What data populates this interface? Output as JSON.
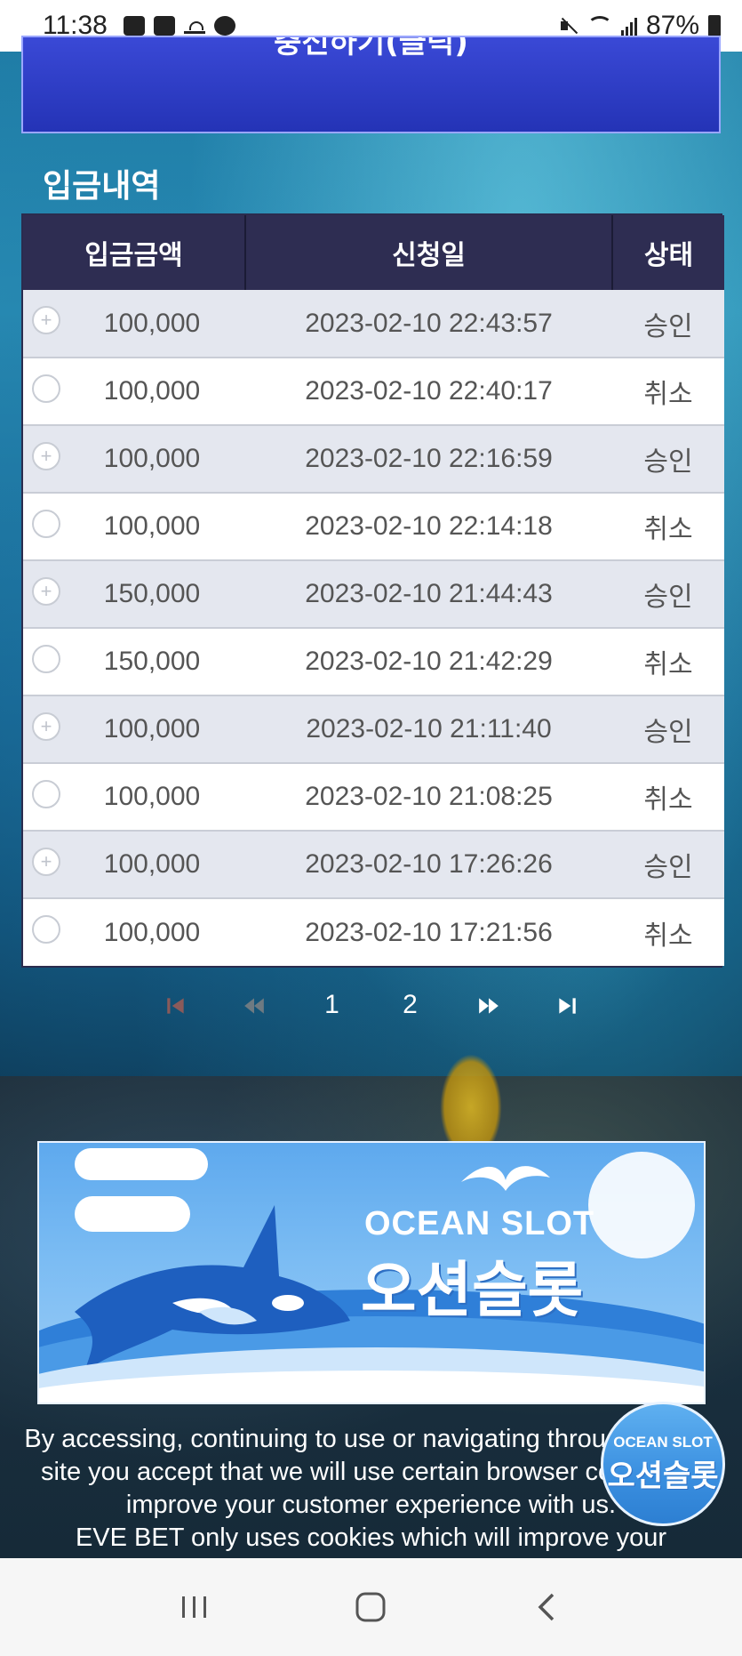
{
  "status_bar": {
    "time": "11:38",
    "battery": "87%"
  },
  "top_button": {
    "label": "충전하기(클릭)"
  },
  "section": {
    "title": "입금내역"
  },
  "table": {
    "headers": [
      "입금금액",
      "신청일",
      "상태"
    ],
    "rows": [
      {
        "amount": "100,000",
        "date": "2023-02-10 22:43:57",
        "status": "승인"
      },
      {
        "amount": "100,000",
        "date": "2023-02-10 22:40:17",
        "status": "취소"
      },
      {
        "amount": "100,000",
        "date": "2023-02-10 22:16:59",
        "status": "승인"
      },
      {
        "amount": "100,000",
        "date": "2023-02-10 22:14:18",
        "status": "취소"
      },
      {
        "amount": "150,000",
        "date": "2023-02-10 21:44:43",
        "status": "승인"
      },
      {
        "amount": "150,000",
        "date": "2023-02-10 21:42:29",
        "status": "취소"
      },
      {
        "amount": "100,000",
        "date": "2023-02-10 21:11:40",
        "status": "승인"
      },
      {
        "amount": "100,000",
        "date": "2023-02-10 21:08:25",
        "status": "취소"
      },
      {
        "amount": "100,000",
        "date": "2023-02-10 17:26:26",
        "status": "승인"
      },
      {
        "amount": "100,000",
        "date": "2023-02-10 17:21:56",
        "status": "취소"
      }
    ]
  },
  "pagination": {
    "pages": [
      "1",
      "2"
    ],
    "icons": [
      "first-page-icon",
      "prev-page-icon",
      "next-page-icon",
      "last-page-icon"
    ]
  },
  "banner": {
    "text_en": "OCEAN SLOT",
    "text_ko": "오션슬롯"
  },
  "badge": {
    "text_en": "OCEAN SLOT",
    "text_ko": "오션슬롯"
  },
  "cookie": {
    "line1": "By accessing, continuing to use or navigating throughout this",
    "line2": "site you accept that we will use certain browser cookies to",
    "line3": "improve your customer experience with us.",
    "line4": "EVE BET only uses cookies which will improve your"
  },
  "colors": {
    "header_bg": "#2e2d52",
    "row_alt": "#e4e7ef",
    "button_blue": "#2433b6"
  }
}
